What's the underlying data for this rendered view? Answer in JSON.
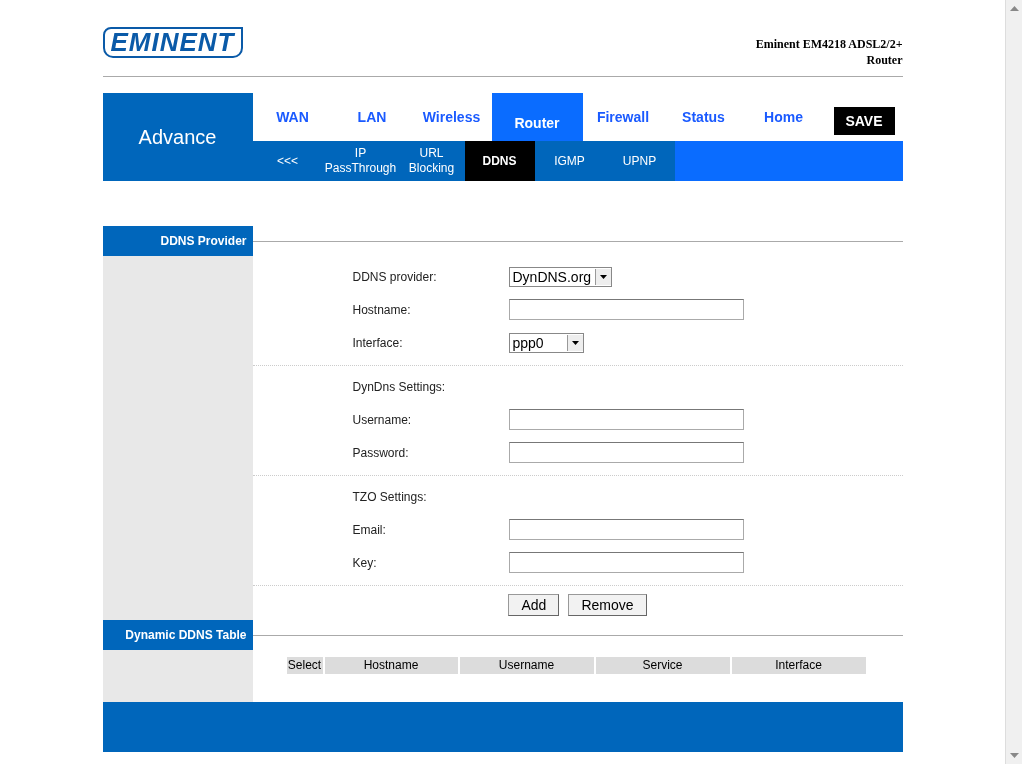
{
  "header": {
    "logo": "EMINENT",
    "model": "Eminent EM4218 ADSL2/2+ Router"
  },
  "nav": {
    "section": "Advance",
    "tabs": [
      {
        "label": "WAN",
        "selected": false
      },
      {
        "label": "LAN",
        "selected": false
      },
      {
        "label": "Wireless",
        "selected": false
      },
      {
        "label": "Router",
        "selected": true
      },
      {
        "label": "Firewall",
        "selected": false
      },
      {
        "label": "Status",
        "selected": false
      },
      {
        "label": "Home",
        "selected": false
      }
    ],
    "save": "SAVE",
    "subtabs": [
      {
        "label": "<<<",
        "selected": false
      },
      {
        "label": "IP PassThrough",
        "selected": false
      },
      {
        "label": "URL Blocking",
        "selected": false
      },
      {
        "label": "DDNS",
        "selected": true
      },
      {
        "label": "IGMP",
        "selected": false
      },
      {
        "label": "UPNP",
        "selected": false
      }
    ]
  },
  "ddns_provider": {
    "title": "DDNS Provider",
    "groups": [
      {
        "rows": [
          {
            "kind": "select",
            "label": "DDNS provider:",
            "value": "DynDNS.org"
          },
          {
            "kind": "input",
            "label": "Hostname:"
          },
          {
            "kind": "select",
            "label": "Interface:",
            "value": "ppp0"
          }
        ]
      },
      {
        "rows": [
          {
            "kind": "heading",
            "label": "DynDns Settings:"
          },
          {
            "kind": "input",
            "label": "Username:"
          },
          {
            "kind": "input",
            "label": "Password:"
          }
        ]
      },
      {
        "rows": [
          {
            "kind": "heading",
            "label": "TZO Settings:"
          },
          {
            "kind": "input",
            "label": "Email:"
          },
          {
            "kind": "input",
            "label": "Key:"
          }
        ]
      }
    ],
    "buttons": [
      "Add",
      "Remove"
    ]
  },
  "ddns_table": {
    "title": "Dynamic DDNS Table",
    "columns": [
      "Select",
      "Hostname",
      "Username",
      "Service",
      "Interface"
    ]
  }
}
